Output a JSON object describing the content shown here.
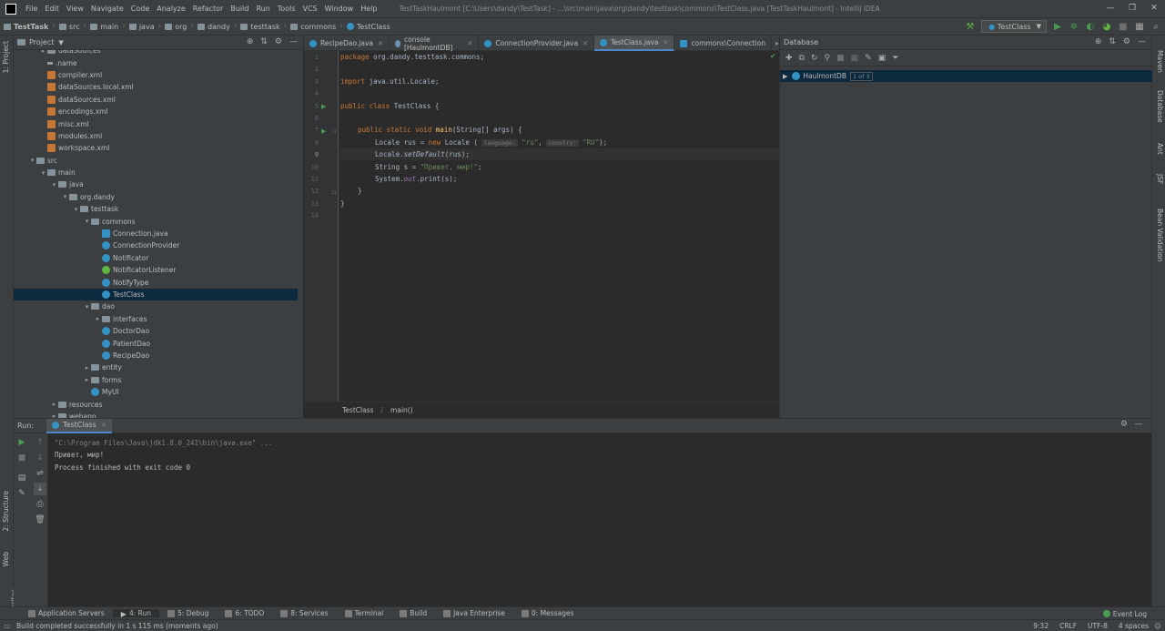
{
  "menubar": {
    "items": [
      "File",
      "Edit",
      "View",
      "Navigate",
      "Code",
      "Analyze",
      "Refactor",
      "Build",
      "Run",
      "Tools",
      "VCS",
      "Window",
      "Help"
    ],
    "window_title": "TestTaskHaulmont [C:\\Users\\dandy\\TestTask] - ...\\src\\main\\java\\org\\dandy\\testtask\\commons\\TestClass.java [TestTaskHaulmont] - IntelliJ IDEA"
  },
  "navbar": {
    "crumbs": [
      "TestTask",
      "src",
      "main",
      "java",
      "org",
      "dandy",
      "testtask",
      "commons",
      "TestClass"
    ],
    "run_config": "TestClass"
  },
  "left_strip": {
    "tabs": [
      "1: Project",
      "2: Structure",
      "Web",
      "2: Favorites"
    ]
  },
  "right_strip": {
    "tabs": [
      "Maven",
      "Database",
      "Ant",
      "JSF",
      "Bean Validation"
    ]
  },
  "project": {
    "header": "Project",
    "tree": [
      {
        "label": "dataSources",
        "depth": 2,
        "icon": "folder",
        "arrow": "▸"
      },
      {
        "label": ".name",
        "depth": 2,
        "icon": "name",
        "arrow": ""
      },
      {
        "label": "compiler.xml",
        "depth": 2,
        "icon": "xml",
        "arrow": ""
      },
      {
        "label": "dataSources.local.xml",
        "depth": 2,
        "icon": "xml",
        "arrow": ""
      },
      {
        "label": "dataSources.xml",
        "depth": 2,
        "icon": "xml",
        "arrow": ""
      },
      {
        "label": "encodings.xml",
        "depth": 2,
        "icon": "xml",
        "arrow": ""
      },
      {
        "label": "misc.xml",
        "depth": 2,
        "icon": "xml",
        "arrow": ""
      },
      {
        "label": "modules.xml",
        "depth": 2,
        "icon": "xml",
        "arrow": ""
      },
      {
        "label": "workspace.xml",
        "depth": 2,
        "icon": "xml",
        "arrow": ""
      },
      {
        "label": "src",
        "depth": 1,
        "icon": "folder",
        "arrow": "▾"
      },
      {
        "label": "main",
        "depth": 2,
        "icon": "folder",
        "arrow": "▾"
      },
      {
        "label": "java",
        "depth": 3,
        "icon": "folder",
        "arrow": "▾"
      },
      {
        "label": "org.dandy",
        "depth": 4,
        "icon": "folder",
        "arrow": "▾"
      },
      {
        "label": "testtask",
        "depth": 5,
        "icon": "folder",
        "arrow": "▾"
      },
      {
        "label": "commons",
        "depth": 6,
        "icon": "folder",
        "arrow": "▾"
      },
      {
        "label": "Connection.java",
        "depth": 7,
        "icon": "javaf",
        "arrow": ""
      },
      {
        "label": "ConnectionProvider",
        "depth": 7,
        "icon": "cls",
        "arrow": ""
      },
      {
        "label": "Notificator",
        "depth": 7,
        "icon": "cls",
        "arrow": ""
      },
      {
        "label": "NotificatorListener",
        "depth": 7,
        "icon": "iface",
        "arrow": ""
      },
      {
        "label": "NotifyType",
        "depth": 7,
        "icon": "enum",
        "arrow": ""
      },
      {
        "label": "TestClass",
        "depth": 7,
        "icon": "cls",
        "arrow": "",
        "selected": true
      },
      {
        "label": "dao",
        "depth": 6,
        "icon": "folder",
        "arrow": "▾"
      },
      {
        "label": "interfaces",
        "depth": 7,
        "icon": "folder",
        "arrow": "▸"
      },
      {
        "label": "DoctorDao",
        "depth": 7,
        "icon": "cls",
        "arrow": ""
      },
      {
        "label": "PatientDao",
        "depth": 7,
        "icon": "cls",
        "arrow": ""
      },
      {
        "label": "RecipeDao",
        "depth": 7,
        "icon": "cls",
        "arrow": ""
      },
      {
        "label": "entity",
        "depth": 6,
        "icon": "folder",
        "arrow": "▸"
      },
      {
        "label": "forms",
        "depth": 6,
        "icon": "folder",
        "arrow": "▸"
      },
      {
        "label": "MyUI",
        "depth": 6,
        "icon": "cls",
        "arrow": ""
      },
      {
        "label": "resources",
        "depth": 3,
        "icon": "folder",
        "arrow": "▸"
      },
      {
        "label": "webapp",
        "depth": 3,
        "icon": "folder",
        "arrow": "▸"
      }
    ]
  },
  "editor": {
    "tabs": [
      {
        "label": "RecipeDao.java",
        "active": false
      },
      {
        "label": "console [HaulmontDB]",
        "active": false
      },
      {
        "label": "ConnectionProvider.java",
        "active": false
      },
      {
        "label": "TestClass.java",
        "active": true
      },
      {
        "label": "commons\\Connection",
        "active": false
      }
    ],
    "line_numbers": [
      "1",
      "2",
      "3",
      "4",
      "5",
      "6",
      "7",
      "8",
      "9",
      "10",
      "11",
      "12",
      "13",
      "14"
    ],
    "code": {
      "l1_kw": "package",
      "l1_rest": " org.dandy.testtask.commons;",
      "l3_kw": "import",
      "l3_rest": " java.util.Locale;",
      "l5_kw": "public class",
      "l5_rest": " TestClass {",
      "l7_kw": "public static void",
      "l7_fn": "main",
      "l7_rest": "(String[] args) {",
      "l8_pre": "Locale rus = ",
      "l8_kw": "new",
      "l8_mid": " Locale ( ",
      "l8_hint1": "language:",
      "l8_s1": "\"ru\"",
      "l8_comma": ", ",
      "l8_hint2": "country:",
      "l8_s2": "\"RU\"",
      "l8_end": ");",
      "l9_pre": "Locale.",
      "l9_st": "setDefault",
      "l9_end": "(rus);",
      "l10_pre": "String s = ",
      "l10_str": "\"Привет, мир!\"",
      "l10_end": ";",
      "l11_pre": "System.",
      "l11_st": "out",
      "l11_end": ".print(s);",
      "l12": "}",
      "l13": "}"
    },
    "breadcrumb": [
      "TestClass",
      "main()"
    ]
  },
  "database": {
    "header": "Database",
    "tree_item": "HaulmontDB",
    "badge": "1 of 3"
  },
  "run": {
    "label": "Run:",
    "tab": "TestClass",
    "console": [
      "\"C:\\Program Files\\Java\\jdk1.8.0_241\\bin\\java.exe\" ...",
      "Привет, мир!",
      "Process finished with exit code 0"
    ]
  },
  "bottom_tabs": [
    "Application Servers",
    "4: Run",
    "5: Debug",
    "6: TODO",
    "8: Services",
    "Terminal",
    "Build",
    "Java Enterprise",
    "0: Messages"
  ],
  "event_log": "Event Log",
  "status": {
    "message": "Build completed successfully in 1 s 115 ms (moments ago)",
    "position": "9:32",
    "line_sep": "CRLF",
    "encoding": "UTF-8",
    "indent": "4 spaces"
  }
}
